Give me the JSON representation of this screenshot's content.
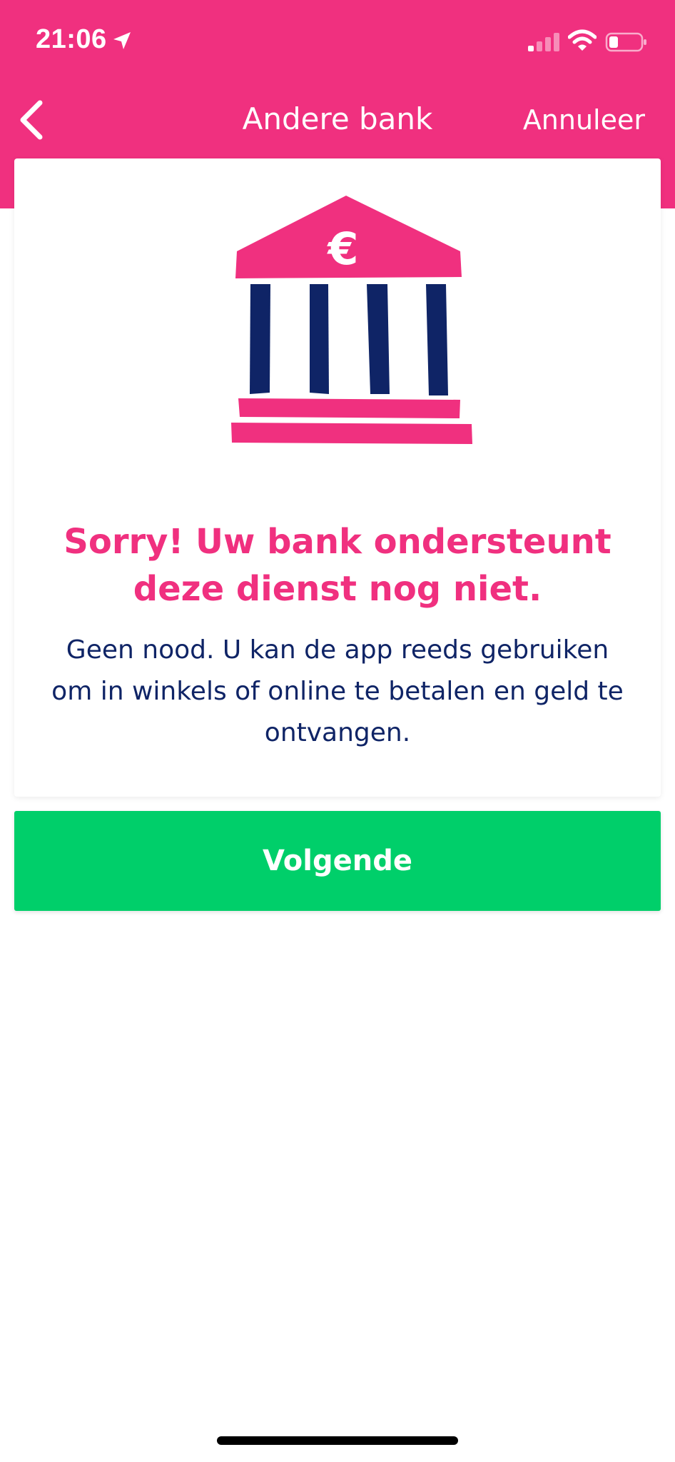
{
  "status_bar": {
    "time": "21:06",
    "icons": [
      "location-arrow-icon",
      "cellular-signal-icon",
      "wifi-icon",
      "battery-icon"
    ]
  },
  "nav": {
    "back_icon": "chevron-left-icon",
    "title": "Andere bank",
    "cancel_label": "Annuleer"
  },
  "card": {
    "illustration": "bank-building-euro-icon",
    "headline": "Sorry! Uw bank ondersteunt deze dienst nog niet.",
    "body": "Geen nood. U kan de app reeds gebruiken om in winkels of online te betalen en geld te ontvangen."
  },
  "actions": {
    "next_label": "Volgende"
  },
  "colors": {
    "brand_pink": "#f0307f",
    "navy": "#0f2466",
    "button_green": "#00cf6a",
    "white": "#ffffff"
  }
}
